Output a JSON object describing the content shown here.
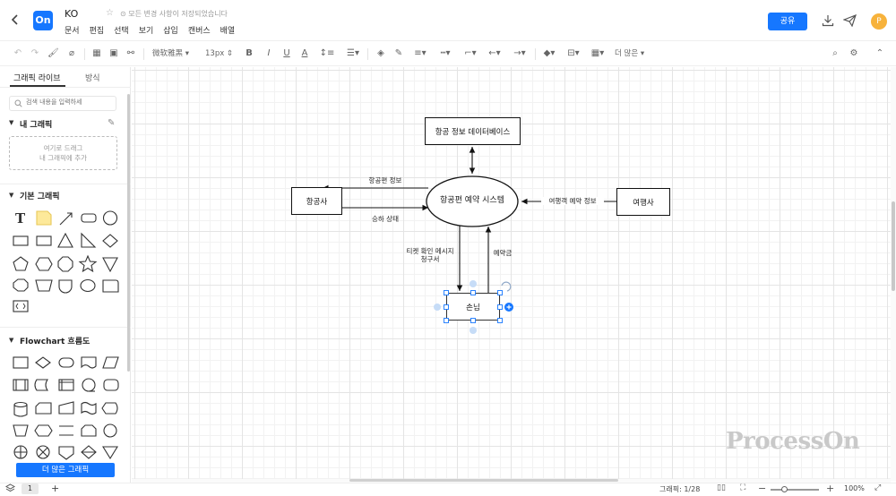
{
  "header": {
    "logo_text": "On",
    "title": "KO",
    "save_status": "모든 변경 사항이 저장되었습니다",
    "menu": [
      "문서",
      "편집",
      "선택",
      "보기",
      "삽입",
      "캔버스",
      "배열"
    ],
    "share_label": "공유",
    "avatar_letter": "P",
    "brand_color": "#1677ff"
  },
  "toolbar": {
    "font_name": "微软雅黑",
    "font_size": "13px",
    "more_label": "더 많은"
  },
  "sidebar": {
    "tabs": [
      "그래픽 라이브",
      "방식"
    ],
    "search_placeholder": "검색 내용을 입력하세",
    "my_shapes": {
      "title": "내 그래픽",
      "drop_hint_line1": "여기로 드래그",
      "drop_hint_line2": "내 그래픽에 추가"
    },
    "basic_title": "기본 그래픽",
    "flowchart_title": "Flowchart 흐름도",
    "more_button": "더 많은 그래픽"
  },
  "diagram": {
    "nodes": {
      "database": "항공 정보 데이터베이스",
      "system": "항공편 예약 시스템",
      "airline": "항공사",
      "agency": "여행사",
      "customer": "손님"
    },
    "edges": {
      "flight_info": "항공편 정보",
      "boarding_status": "승하 상태",
      "traveler_info": "여행객 예약 정보",
      "ticket_line1": "티켓 확인 메시지",
      "ticket_line2": "청구서",
      "payment": "예약금"
    }
  },
  "watermark": "ProcessOn",
  "status_bar": {
    "page_number": "1",
    "shape_count": "그래픽: 1/28",
    "zoom": "100%"
  }
}
